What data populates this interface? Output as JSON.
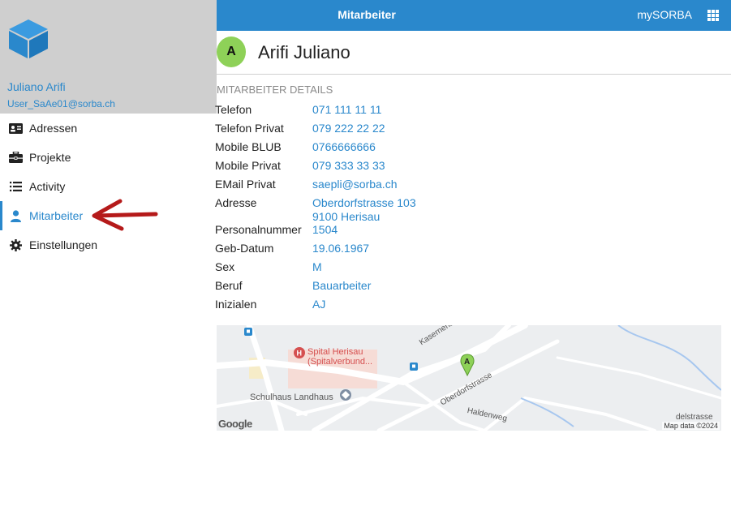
{
  "topbar": {
    "title": "Mitarbeiter",
    "brand": "mySORBA"
  },
  "sidebar": {
    "user_name": "Juliano Arifi",
    "user_email": "User_SaAe01@sorba.ch",
    "items": [
      {
        "label": "Adressen",
        "icon": "address-card-icon"
      },
      {
        "label": "Projekte",
        "icon": "toolbox-icon"
      },
      {
        "label": "Activity",
        "icon": "list-icon"
      },
      {
        "label": "Mitarbeiter",
        "icon": "person-icon",
        "active": true
      },
      {
        "label": "Einstellungen",
        "icon": "gear-icon"
      }
    ]
  },
  "person": {
    "initial": "A",
    "name": "Arifi Juliano"
  },
  "details": {
    "section_title": "MITARBEITER DETAILS",
    "rows": [
      {
        "label": "Telefon",
        "value": "071 111 11 11"
      },
      {
        "label": "Telefon Privat",
        "value": "079 222 22 22"
      },
      {
        "label": "Mobile BLUB",
        "value": "0766666666"
      },
      {
        "label": "Mobile  Privat",
        "value": "079 333 33 33"
      },
      {
        "label": "EMail   Privat",
        "value": "saepli@sorba.ch"
      },
      {
        "label": "Adresse",
        "value": "Oberdorfstrasse 103",
        "value2": "9100 Herisau"
      },
      {
        "label": "Personalnummer",
        "value": "1504"
      },
      {
        "label": "Geb-Datum",
        "value": "19.06.1967"
      },
      {
        "label": "Sex",
        "value": "M"
      },
      {
        "label": "Beruf",
        "value": "Bauarbeiter"
      },
      {
        "label": "Inizialen",
        "value": "AJ"
      }
    ]
  },
  "map": {
    "hospital_line1": "Spital Herisau",
    "hospital_line2": "(Spitalverbund...",
    "school": "Schulhaus Landhaus",
    "street1": "Kasernenstrasse",
    "street2": "Oberdorfstrasse",
    "street3": "Haldenweg",
    "street4": "delstrasse",
    "marker": "A",
    "google": "Google",
    "credit": "Map data ©2024"
  },
  "colors": {
    "accent": "#2a88cc",
    "avatar": "#8ed158",
    "arrow": "#b51a1a",
    "sidebar_header": "#cfcfcf"
  }
}
